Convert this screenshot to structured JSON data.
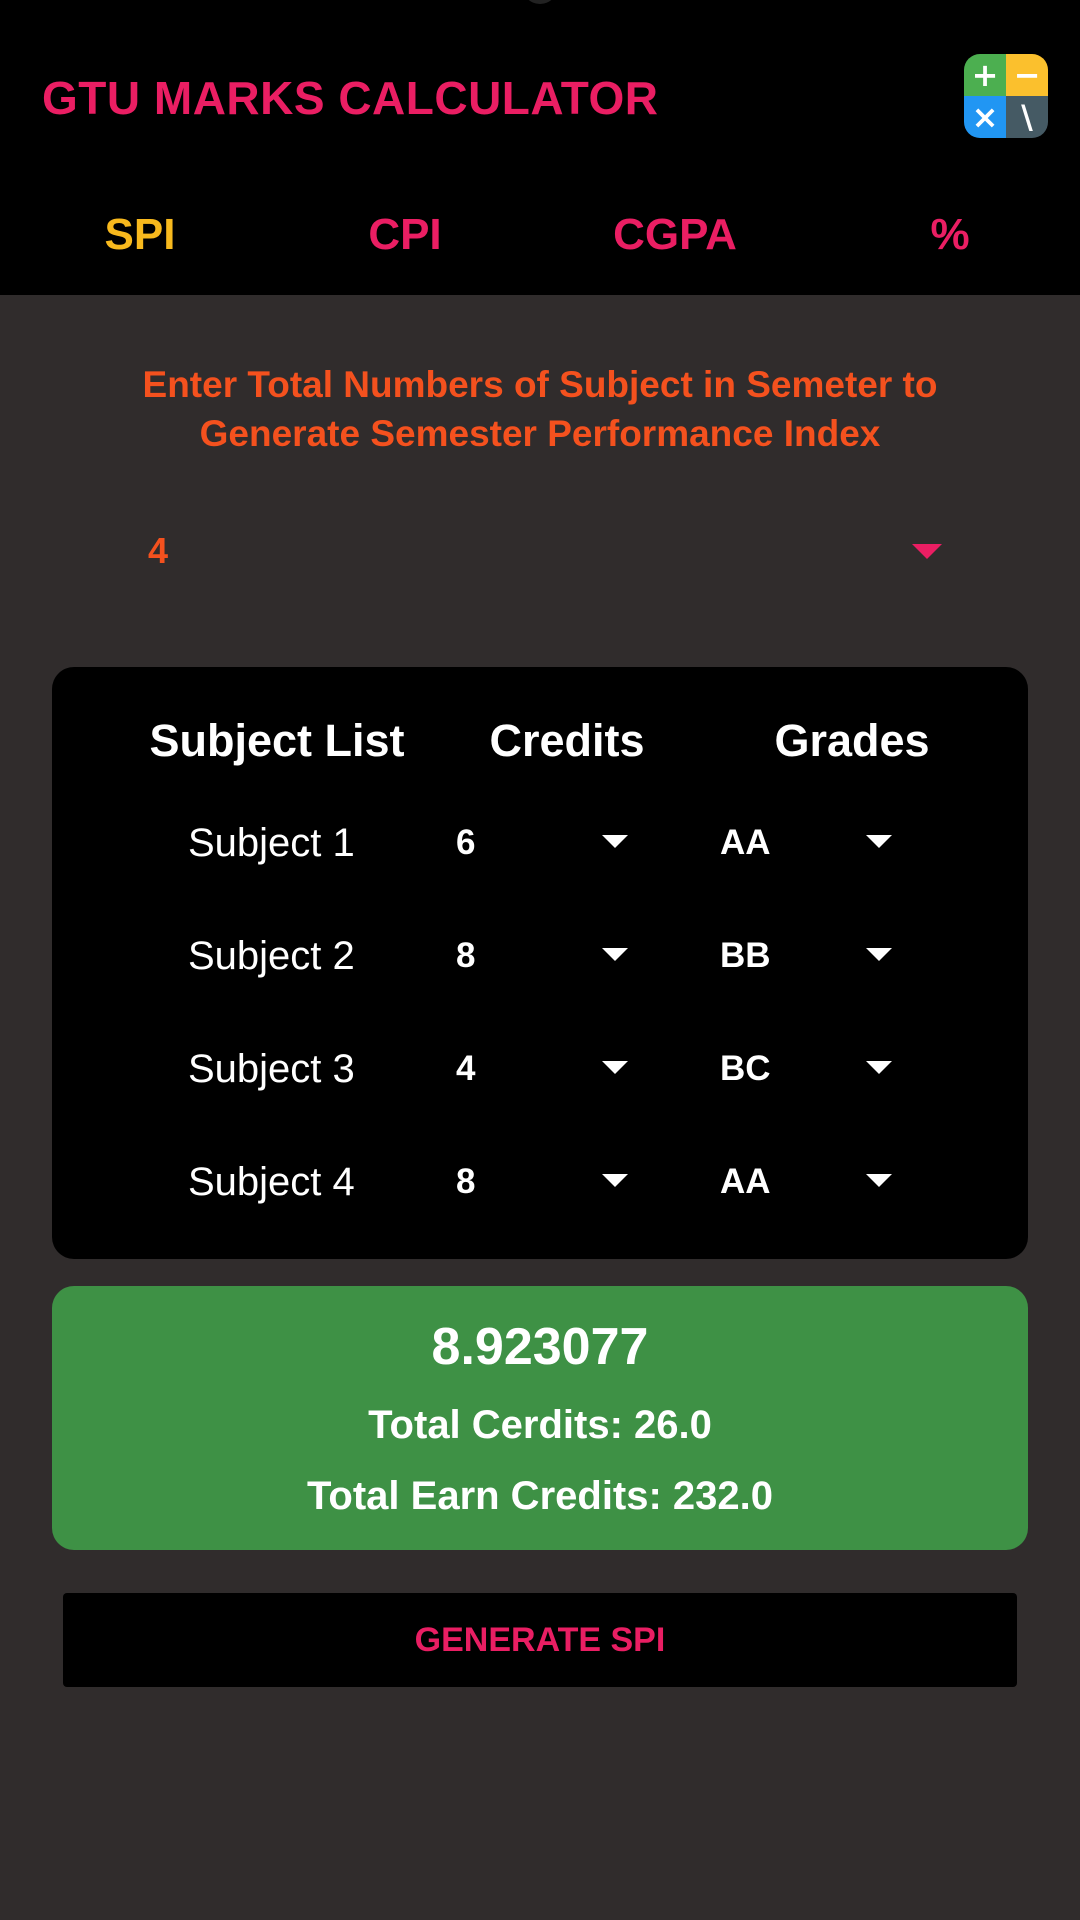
{
  "app": {
    "title": "GTU MARKS CALCULATOR",
    "logo_icon": "calculator-icon"
  },
  "tabs": [
    {
      "label": "SPI",
      "active": true
    },
    {
      "label": "CPI",
      "active": false
    },
    {
      "label": "CGPA",
      "active": false
    },
    {
      "label": "%",
      "active": false
    }
  ],
  "instruction": "Enter Total Numbers of Subject in Semeter to Generate Semester Performance Index",
  "subject_count": {
    "value": "4",
    "icon": "dropdown-arrow-icon"
  },
  "table": {
    "headers": {
      "subject": "Subject List",
      "credits": "Credits",
      "grades": "Grades"
    },
    "rows": [
      {
        "subject": "Subject 1",
        "credit": "6",
        "grade": "AA"
      },
      {
        "subject": "Subject 2",
        "credit": "8",
        "grade": "BB"
      },
      {
        "subject": "Subject 3",
        "credit": "4",
        "grade": "BC"
      },
      {
        "subject": "Subject 4",
        "credit": "8",
        "grade": "AA"
      }
    ]
  },
  "result": {
    "spi": "8.923077",
    "total_credits": "Total Cerdits: 26.0",
    "total_earn_credits": "Total Earn Credits: 232.0"
  },
  "generate_button": "GENERATE SPI",
  "colors": {
    "background": "#302c2c",
    "header": "#000000",
    "accent_pink": "#ea1e63",
    "accent_yellow": "#f8b91d",
    "accent_orange": "#f4511e",
    "result_green": "#3e9145"
  }
}
